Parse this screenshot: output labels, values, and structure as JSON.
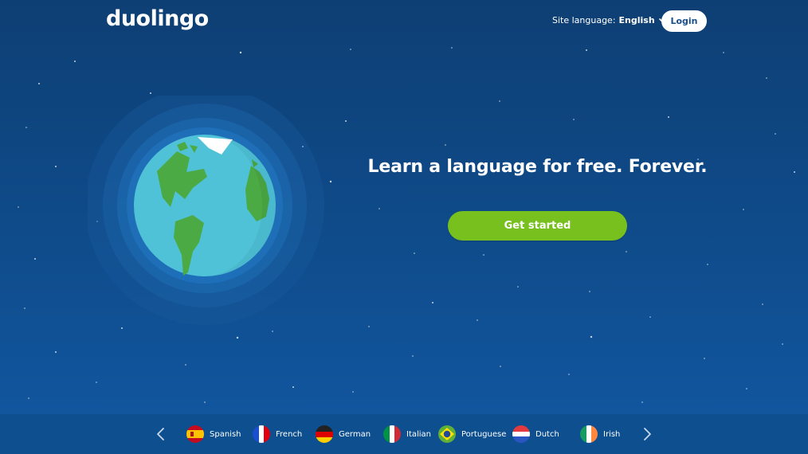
{
  "header": {
    "logo_text": "duolingo",
    "site_language_label": "Site language:",
    "site_language_value": "English",
    "login_label": "Login"
  },
  "hero": {
    "headline": "Learn a language for free. Forever.",
    "cta_label": "Get started"
  },
  "language_bar": {
    "languages": [
      {
        "name": "Spanish",
        "flag": "spain-flag-icon"
      },
      {
        "name": "French",
        "flag": "france-flag-icon"
      },
      {
        "name": "German",
        "flag": "germany-flag-icon"
      },
      {
        "name": "Italian",
        "flag": "italy-flag-icon"
      },
      {
        "name": "Portuguese",
        "flag": "brazil-flag-icon"
      },
      {
        "name": "Dutch",
        "flag": "netherlands-flag-icon"
      },
      {
        "name": "Irish",
        "flag": "ireland-flag-icon"
      }
    ],
    "prev_icon": "chevron-left-icon",
    "next_icon": "chevron-right-icon"
  },
  "colors": {
    "background": "#0f4c8c",
    "cta": "#78c01e",
    "ocean": "#4fc2d8",
    "land": "#4caa44"
  }
}
